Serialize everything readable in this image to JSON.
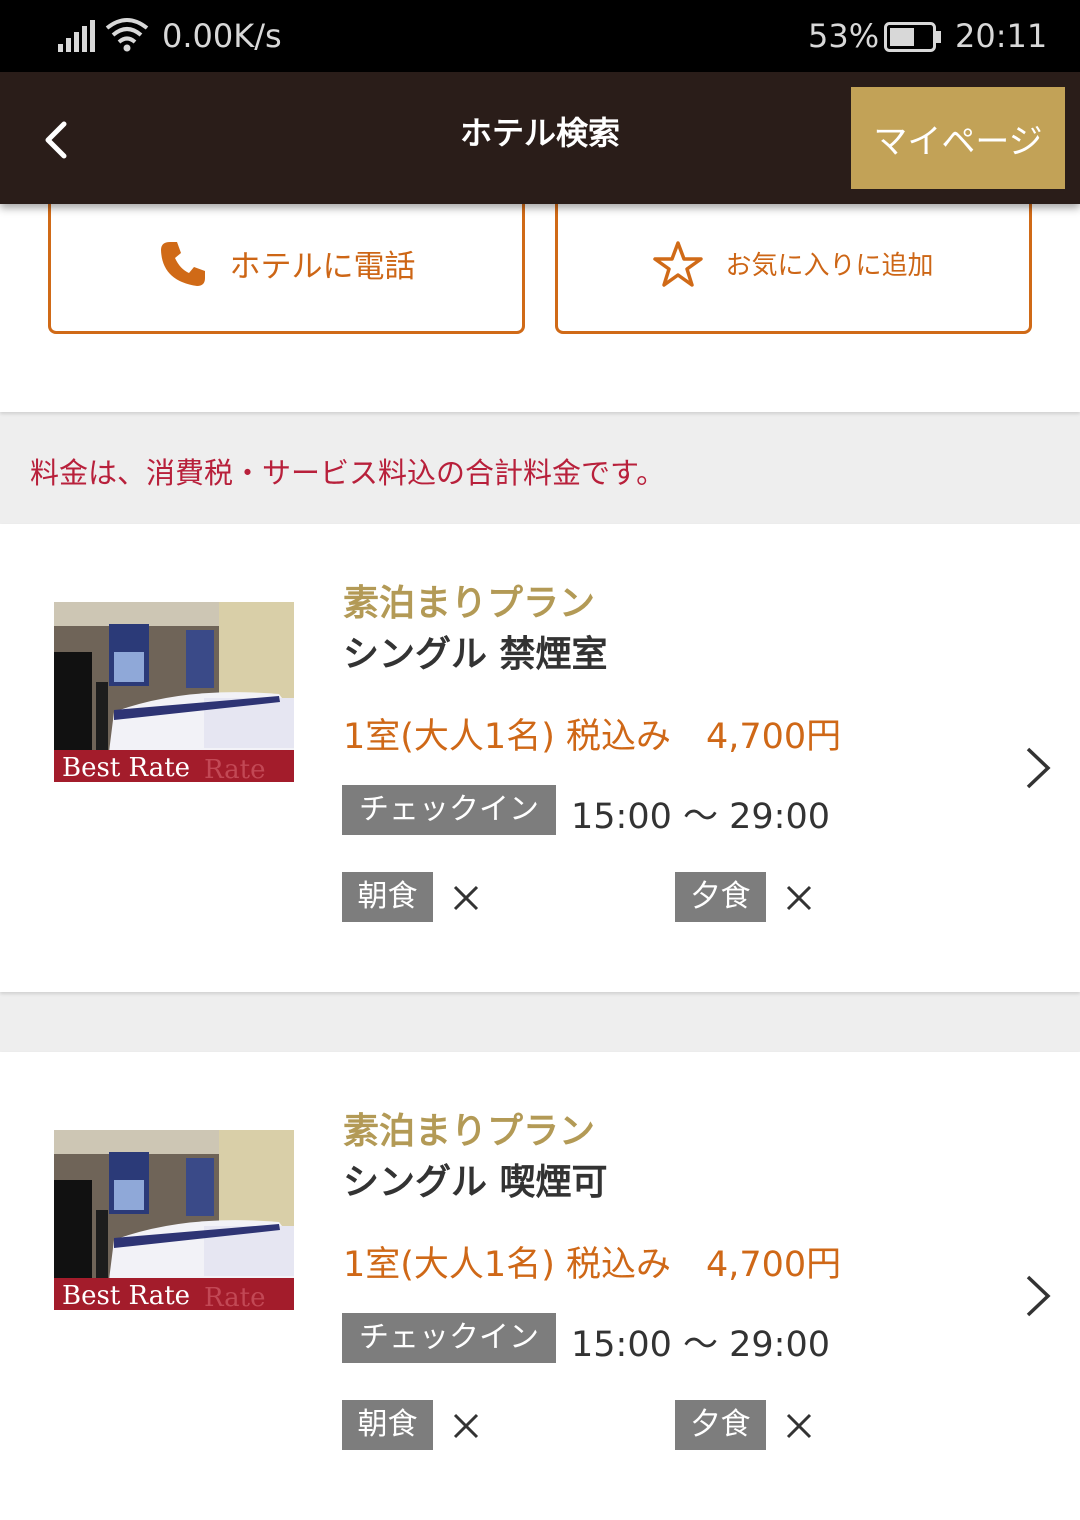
{
  "status_bar": {
    "network_speed": "0.00K/s",
    "battery": "53%",
    "time": "20:11"
  },
  "header": {
    "title": "ホテル検索",
    "mypage_label": "マイページ"
  },
  "actions": {
    "call_label": "ホテルに電話",
    "favorite_label": "お気に入りに追加"
  },
  "notice": "料金は、消費税・サービス料込の合計料金です。",
  "plans": [
    {
      "badge": "Best Rate",
      "plan_name": "素泊まりプラン",
      "room_type": "シングル 禁煙室",
      "price": "1室(大人1名) 税込み　4,700円",
      "checkin_label": "チェックイン",
      "checkin_time": "15:00 〜 29:00",
      "breakfast_label": "朝食",
      "dinner_label": "夕食"
    },
    {
      "badge": "Best Rate",
      "plan_name": "素泊まりプラン",
      "room_type": "シングル 喫煙可",
      "price": "1室(大人1名) 税込み　4,700円",
      "checkin_label": "チェックイン",
      "checkin_time": "15:00 〜 29:00",
      "breakfast_label": "朝食",
      "dinner_label": "夕食"
    }
  ],
  "colors": {
    "header_bg": "#2a1d19",
    "mypage_bg": "#c2a257",
    "accent_orange": "#cd6616",
    "notice_red": "#b8203b",
    "plan_gold": "#b39a56"
  },
  "icons": {
    "back": "chevron-left-icon",
    "call": "phone-icon",
    "favorite": "star-icon",
    "detail": "chevron-right-icon",
    "unavailable": "x-mark-icon"
  }
}
